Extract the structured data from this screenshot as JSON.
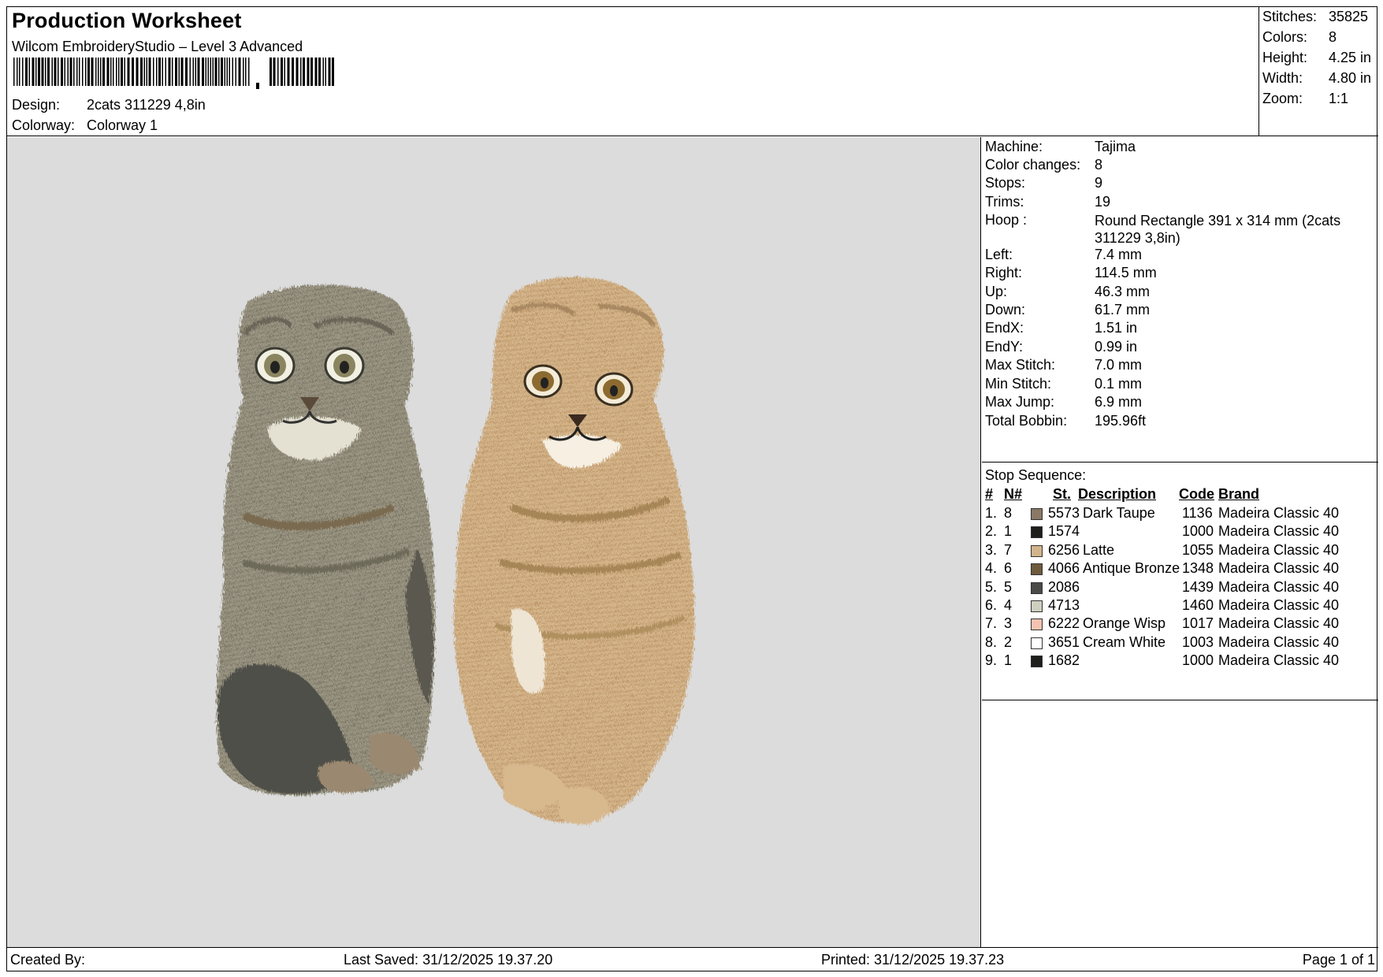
{
  "header": {
    "title": "Production Worksheet",
    "software": "Wilcom EmbroideryStudio – Level 3 Advanced",
    "design_label": "Design:",
    "design_value": "2cats 311229 4,8in",
    "colorway_label": "Colorway:",
    "colorway_value": "Colorway 1"
  },
  "stats": {
    "stitches_label": "Stitches:",
    "stitches_value": "35825",
    "colors_label": "Colors:",
    "colors_value": "8",
    "height_label": "Height:",
    "height_value": "4.25 in",
    "width_label": "Width:",
    "width_value": "4.80 in",
    "zoom_label": "Zoom:",
    "zoom_value": "1:1"
  },
  "info": {
    "machine_label": "Machine:",
    "machine_value": "Tajima",
    "color_changes_label": "Color changes:",
    "color_changes_value": "8",
    "stops_label": "Stops:",
    "stops_value": "9",
    "trims_label": "Trims:",
    "trims_value": "19",
    "hoop_label": "Hoop :",
    "hoop_value": "Round Rectangle 391 x 314 mm (2cats 311229 3,8in)",
    "left_label": "Left:",
    "left_value": "7.4 mm",
    "right_label": "Right:",
    "right_value": "114.5 mm",
    "up_label": "Up:",
    "up_value": "46.3 mm",
    "down_label": "Down:",
    "down_value": "61.7 mm",
    "endx_label": "EndX:",
    "endx_value": "1.51 in",
    "endy_label": "EndY:",
    "endy_value": "0.99 in",
    "max_stitch_label": "Max Stitch:",
    "max_stitch_value": "7.0 mm",
    "min_stitch_label": "Min Stitch:",
    "min_stitch_value": "0.1 mm",
    "max_jump_label": "Max Jump:",
    "max_jump_value": "6.9 mm",
    "total_bobbin_label": "Total Bobbin:",
    "total_bobbin_value": "195.96ft"
  },
  "stop_sequence": {
    "title": "Stop Sequence:",
    "headers": {
      "num": "#",
      "n": "N#",
      "st": "St.",
      "description": "Description",
      "code": "Code",
      "brand": "Brand"
    },
    "rows": [
      {
        "num": "1.",
        "n": "8",
        "color": "#8a7866",
        "st": "5573",
        "description": "Dark Taupe",
        "code": "1136",
        "brand": "Madeira Classic 40"
      },
      {
        "num": "2.",
        "n": "1",
        "color": "#1e1e1c",
        "st": "1574",
        "description": "",
        "code": "1000",
        "brand": "Madeira Classic 40"
      },
      {
        "num": "3.",
        "n": "7",
        "color": "#d2b48c",
        "st": "6256",
        "description": "Latte",
        "code": "1055",
        "brand": "Madeira Classic 40"
      },
      {
        "num": "4.",
        "n": "6",
        "color": "#6e5a3c",
        "st": "4066",
        "description": "Antique Bronze",
        "code": "1348",
        "brand": "Madeira Classic 40"
      },
      {
        "num": "5.",
        "n": "5",
        "color": "#4a4a48",
        "st": "2086",
        "description": "",
        "code": "1439",
        "brand": "Madeira Classic 40"
      },
      {
        "num": "6.",
        "n": "4",
        "color": "#cfcfc0",
        "st": "4713",
        "description": "",
        "code": "1460",
        "brand": "Madeira Classic 40"
      },
      {
        "num": "7.",
        "n": "3",
        "color": "#f4c2b0",
        "st": "6222",
        "description": "Orange Wisp",
        "code": "1017",
        "brand": "Madeira Classic 40"
      },
      {
        "num": "8.",
        "n": "2",
        "color": "#ffffff",
        "st": "3651",
        "description": "Cream White",
        "code": "1003",
        "brand": "Madeira Classic 40"
      },
      {
        "num": "9.",
        "n": "1",
        "color": "#1e1e1c",
        "st": "1682",
        "description": "",
        "code": "1000",
        "brand": "Madeira Classic 40"
      }
    ]
  },
  "footer": {
    "created_by": "Created By:",
    "last_saved": "Last Saved: 31/12/2025 19.37.20",
    "printed": "Printed: 31/12/2025 19.37.23",
    "page": "Page 1 of 1"
  }
}
